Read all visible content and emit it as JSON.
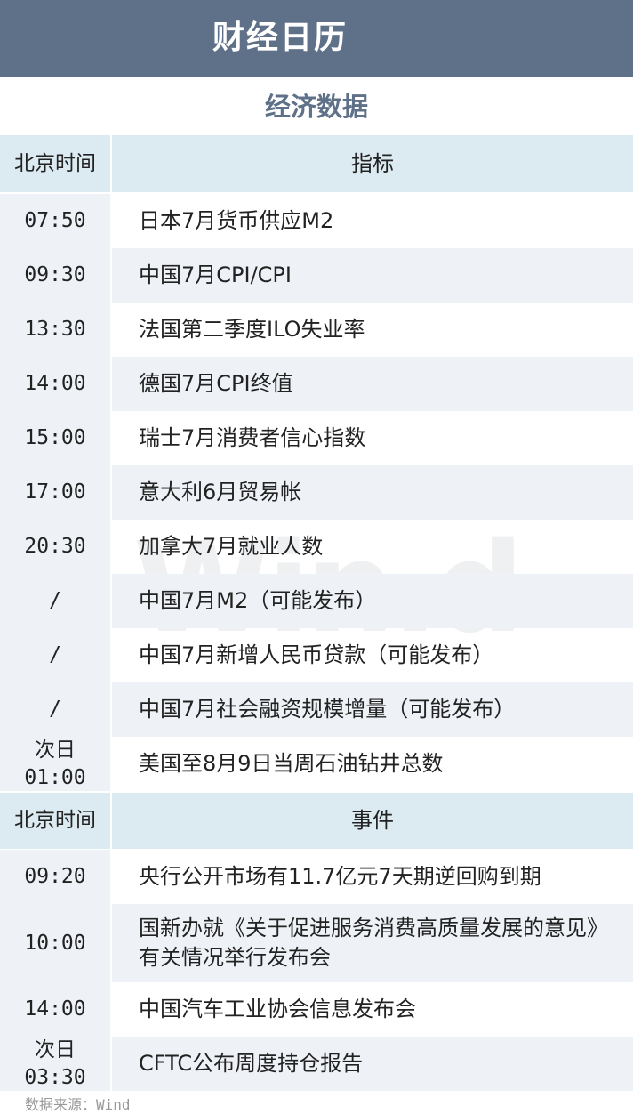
{
  "title": "财经日历",
  "section_title": "经济数据",
  "econ_header": {
    "time": "北京时间",
    "item": "指标"
  },
  "econ_rows": [
    {
      "time": "07:50",
      "item": "日本7月货币供应M2"
    },
    {
      "time": "09:30",
      "item": "中国7月CPI/CPI"
    },
    {
      "time": "13:30",
      "item": "法国第二季度ILO失业率"
    },
    {
      "time": "14:00",
      "item": "德国7月CPI终值"
    },
    {
      "time": "15:00",
      "item": "瑞士7月消费者信心指数"
    },
    {
      "time": "17:00",
      "item": "意大利6月贸易帐"
    },
    {
      "time": "20:30",
      "item": "加拿大7月就业人数"
    },
    {
      "time": "/",
      "item": "中国7月M2（可能发布）"
    },
    {
      "time": "/",
      "item": "中国7月新增人民币贷款（可能发布）"
    },
    {
      "time": "/",
      "item": "中国7月社会融资规模增量（可能发布）"
    },
    {
      "day": "次日",
      "time": "01:00",
      "item": "美国至8月9日当周石油钻井总数"
    }
  ],
  "event_header": {
    "time": "北京时间",
    "item": "事件"
  },
  "event_rows": [
    {
      "time": "09:20",
      "item": "央行公开市场有11.7亿元7天期逆回购到期"
    },
    {
      "time": "10:00",
      "item": "国新办就《关于促进服务消费高质量发展的意见》有关情况举行发布会"
    },
    {
      "time": "14:00",
      "item": "中国汽车工业协会信息发布会"
    },
    {
      "day": "次日",
      "time": "03:30",
      "item": "CFTC公布周度持仓报告"
    }
  ],
  "watermark": "Win.d",
  "source": "数据来源：Wind"
}
